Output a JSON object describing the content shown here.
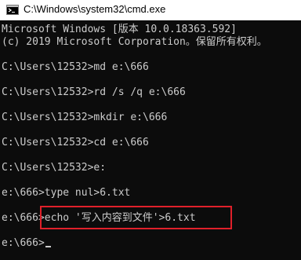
{
  "window": {
    "title": "C:\\Windows\\system32\\cmd.exe"
  },
  "console": {
    "lines": [
      "Microsoft Windows [版本 10.0.18363.592]",
      "(c) 2019 Microsoft Corporation。保留所有权利。",
      "",
      "C:\\Users\\12532>md e:\\666",
      "",
      "C:\\Users\\12532>rd /s /q e:\\666",
      "",
      "C:\\Users\\12532>mkdir e:\\666",
      "",
      "C:\\Users\\12532>cd e:\\666",
      "",
      "C:\\Users\\12532>e:",
      "",
      "e:\\666>type nul>6.txt",
      "",
      "e:\\666>echo '写入内容到文件'>6.txt",
      "",
      "e:\\666>"
    ]
  },
  "colors": {
    "console_background": "#0c0c0c",
    "console_text": "#cccccc",
    "titlebar_background": "#ffffff",
    "highlight_border": "#e0202a"
  },
  "icons": {
    "app": "cmd-console-icon"
  }
}
